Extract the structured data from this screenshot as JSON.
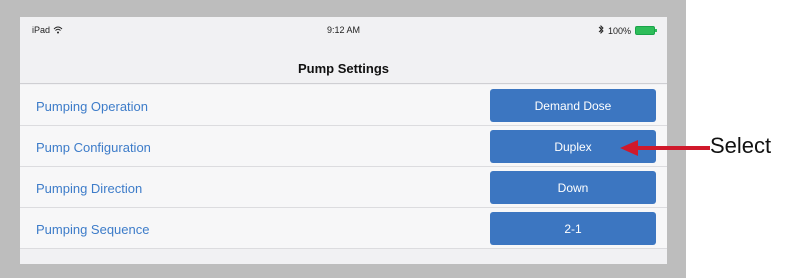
{
  "status_bar": {
    "device": "iPad",
    "time": "9:12 AM",
    "battery_text": "100%"
  },
  "screen": {
    "title": "Pump Settings"
  },
  "settings": [
    {
      "label": "Pumping Operation",
      "value": "Demand Dose"
    },
    {
      "label": "Pump Configuration",
      "value": "Duplex"
    },
    {
      "label": "Pumping Direction",
      "value": "Down"
    },
    {
      "label": "Pumping Sequence",
      "value": "2-1"
    }
  ],
  "annotation": {
    "label": "Select",
    "arrow_color": "#d0192b"
  },
  "colors": {
    "accent": "#3c76c1",
    "label_text": "#3d7cc9"
  },
  "icons": [
    "wifi-icon",
    "bluetooth-icon",
    "battery-icon"
  ]
}
